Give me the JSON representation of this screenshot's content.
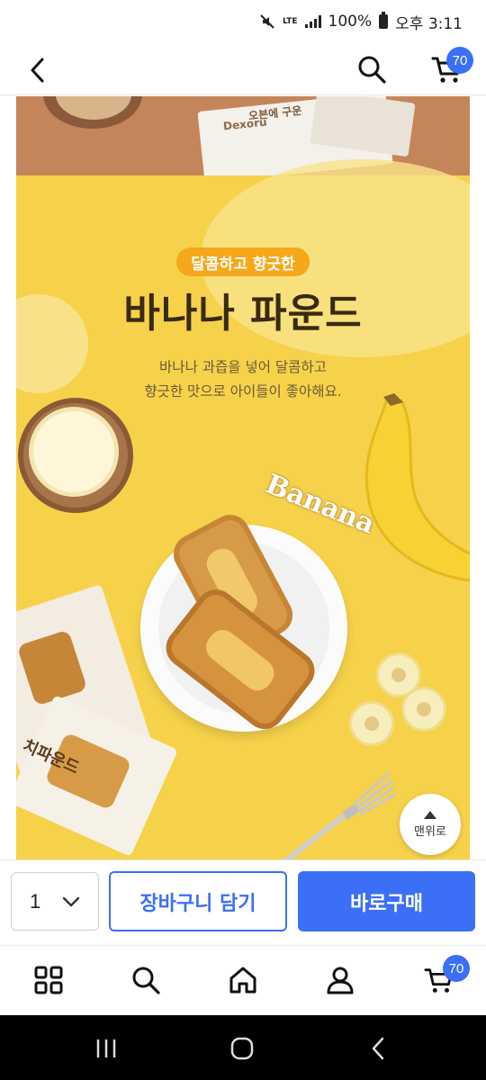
{
  "status_bar": {
    "network": "LTE",
    "battery": "100%",
    "time": "오후 3:11"
  },
  "top_nav": {
    "cart_count": "70"
  },
  "product_image": {
    "package_text_top": "오븐에 구운",
    "package_brand": "Dexoru",
    "tagline": "달콤하고 향긋한",
    "title": "바나나 파운드",
    "desc_line1": "바나나 과즙을 넣어 달콤하고",
    "desc_line2": "향긋한 맛으로 아이들이 좋아해요.",
    "banana_word": "Banana",
    "package_text_left": "치파운드"
  },
  "scroll_top": {
    "label": "맨위로"
  },
  "purchase_bar": {
    "quantity": "1",
    "add_to_cart": "장바구니 담기",
    "buy_now": "바로구매"
  },
  "bottom_nav": {
    "cart_count": "70",
    "items": [
      "category-icon",
      "search-icon",
      "home-icon",
      "user-icon",
      "cart-icon"
    ]
  },
  "colors": {
    "accent": "#3b6ff5",
    "banner_yellow": "#f6d24a",
    "tag_orange": "#f4a81a",
    "title_brown": "#3a2a12"
  }
}
